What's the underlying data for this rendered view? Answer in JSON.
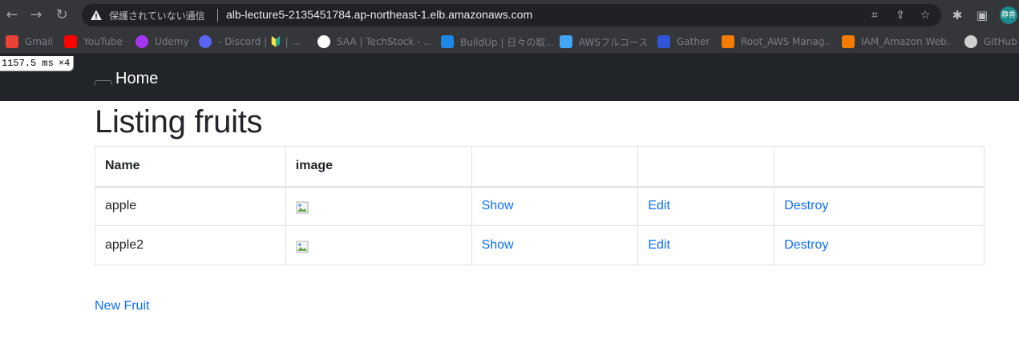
{
  "browser": {
    "security_status": "保護されていない通信",
    "url": "alb-lecture5-2135451784.ap-northeast-1.elb.amazonaws.com",
    "profile_label": "静香",
    "bookmarks": [
      {
        "label": "Gmail",
        "color": "#ea4335"
      },
      {
        "label": "YouTube",
        "color": "#ff0000"
      },
      {
        "label": "Udemy",
        "color": "#a435f0"
      },
      {
        "label": "- Discord | 🔰 | ...",
        "color": "#5865f2"
      },
      {
        "label": "SAA | TechStock - ...",
        "color": "#ffffff"
      },
      {
        "label": "BuildUp | 日々の取...",
        "color": "#1e88e5"
      },
      {
        "label": "AWSフルコース",
        "color": "#42a5f5"
      },
      {
        "label": "Gather",
        "color": "#2f55d4"
      },
      {
        "label": "Root_AWS Manag...",
        "color": "#f57c00"
      },
      {
        "label": "IAM_Amazon Web...",
        "color": "#f57c00"
      },
      {
        "label": "GitHub",
        "color": "#d0d0d0"
      }
    ]
  },
  "perf_overlay": {
    "value": "1157.5",
    "unit": "ms",
    "multiplier": "×4"
  },
  "navbar": {
    "brand": "Home"
  },
  "page": {
    "title": "Listing fruits",
    "new_link": "New Fruit"
  },
  "table": {
    "headers": [
      "Name",
      "image",
      "",
      "",
      ""
    ],
    "rows": [
      {
        "name": "apple",
        "show": "Show",
        "edit": "Edit",
        "destroy": "Destroy"
      },
      {
        "name": "apple2",
        "show": "Show",
        "edit": "Edit",
        "destroy": "Destroy"
      }
    ]
  }
}
